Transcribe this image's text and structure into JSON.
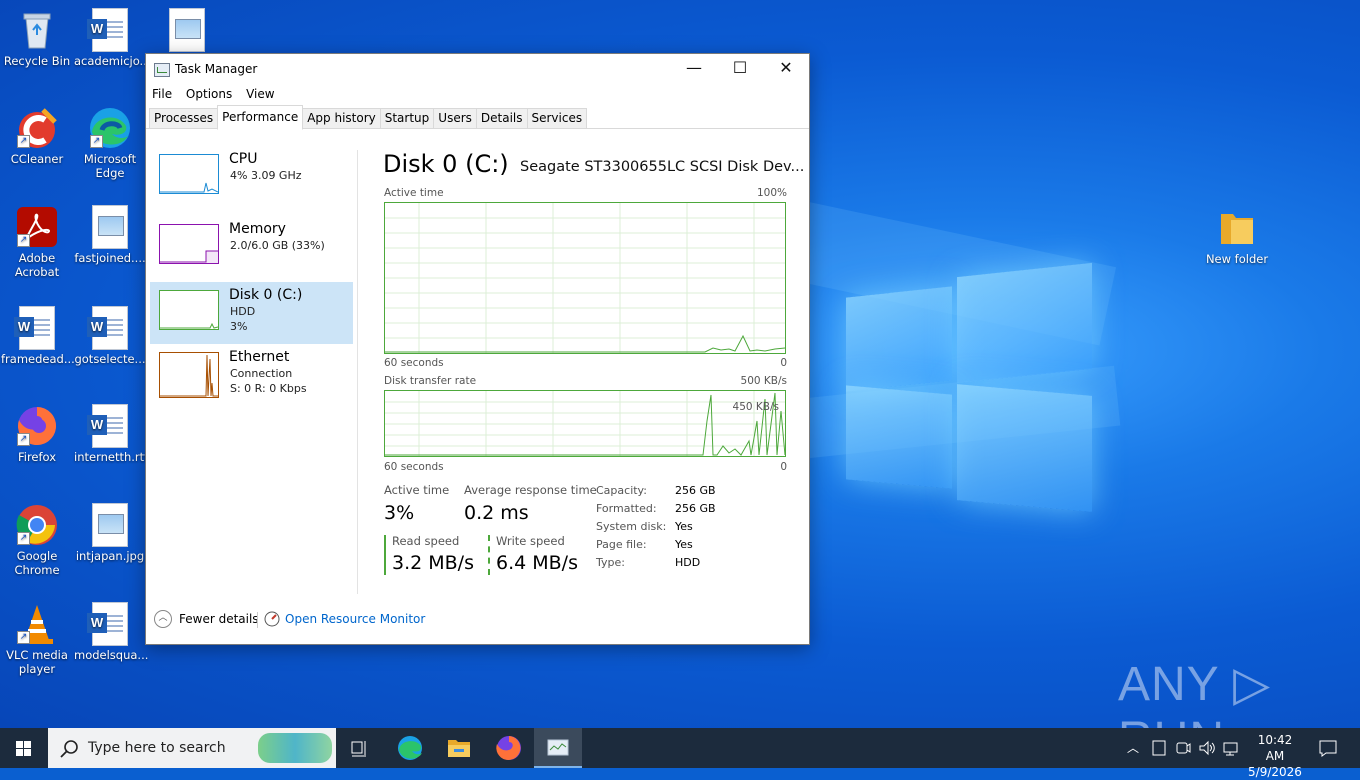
{
  "desktop": {
    "icons": [
      {
        "label": "Recycle Bin"
      },
      {
        "label": "academicjo..."
      },
      {
        "label": "CCleaner"
      },
      {
        "label": "Microsoft Edge"
      },
      {
        "label": "Adobe Acrobat"
      },
      {
        "label": "fastjoined...."
      },
      {
        "label": "framedead..."
      },
      {
        "label": "gotselecte..."
      },
      {
        "label": "Firefox"
      },
      {
        "label": "internetth.rtf"
      },
      {
        "label": "Google Chrome"
      },
      {
        "label": "intjapan.jpg"
      },
      {
        "label": "VLC media player"
      },
      {
        "label": "modelsqua..."
      },
      {
        "label": "New folder"
      }
    ],
    "watermark": "ANY ▷ RUN"
  },
  "window": {
    "title": "Task Manager",
    "controls": {
      "minimize": "—",
      "maximize": "☐",
      "close": "✕"
    },
    "menu": [
      "File",
      "Options",
      "View"
    ],
    "tabs": [
      "Processes",
      "Performance",
      "App history",
      "Startup",
      "Users",
      "Details",
      "Services"
    ],
    "active_tab": "Performance"
  },
  "perf_list": [
    {
      "name": "CPU",
      "line1": "4%  3.09 GHz",
      "line2": "",
      "color": "#1b8bd4"
    },
    {
      "name": "Memory",
      "line1": "2.0/6.0 GB (33%)",
      "line2": "",
      "color": "#8b12ae"
    },
    {
      "name": "Disk 0 (C:)",
      "line1": "HDD",
      "line2": "3%",
      "color": "#4da83b"
    },
    {
      "name": "Ethernet",
      "line1": "Connection",
      "line2": "S: 0  R: 0 Kbps",
      "color": "#a74f01"
    }
  ],
  "detail": {
    "title": "Disk 0 (C:)",
    "model": "Seagate ST3300655LC SCSI Disk Dev...",
    "graph1": {
      "label": "Active time",
      "max": "100%",
      "xlabel": "60 seconds",
      "min": "0"
    },
    "graph2": {
      "label": "Disk transfer rate",
      "max": "500 KB/s",
      "inner": "450 KB/s",
      "xlabel": "60 seconds",
      "min": "0"
    },
    "stats": {
      "active_time_label": "Active time",
      "active_time": "3%",
      "avg_resp_label": "Average response time",
      "avg_resp": "0.2 ms",
      "read_label": "Read speed",
      "read": "3.2 MB/s",
      "write_label": "Write speed",
      "write": "6.4 MB/s"
    },
    "props": [
      {
        "k": "Capacity:",
        "v": "256 GB"
      },
      {
        "k": "Formatted:",
        "v": "256 GB"
      },
      {
        "k": "System disk:",
        "v": "Yes"
      },
      {
        "k": "Page file:",
        "v": "Yes"
      },
      {
        "k": "Type:",
        "v": "HDD"
      }
    ]
  },
  "footer": {
    "fewer": "Fewer details",
    "resmon": "Open Resource Monitor"
  },
  "taskbar": {
    "search_placeholder": "Type here to search",
    "time": "10:42 AM",
    "date": "5/9/2026"
  },
  "colors": {
    "accent": "#0078d7",
    "disk_green": "#4da83b",
    "taskbar": "#1c2b3d"
  }
}
